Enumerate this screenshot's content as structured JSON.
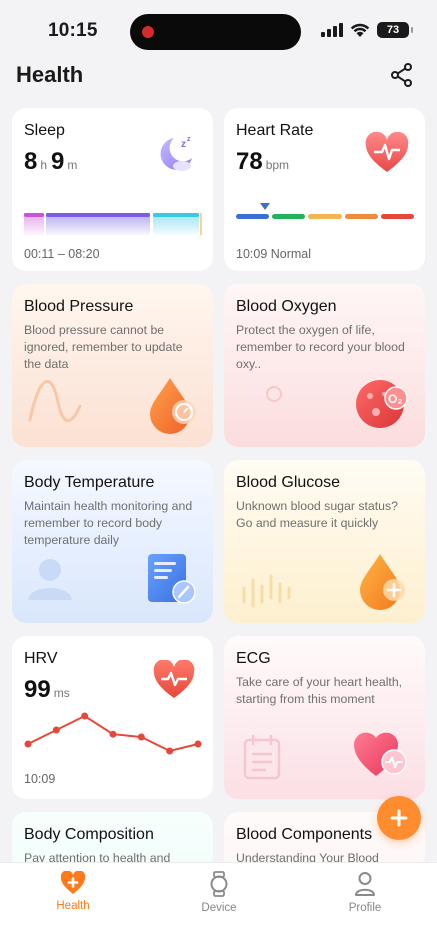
{
  "status_bar": {
    "time": "10:15",
    "battery": "73"
  },
  "header": {
    "title": "Health"
  },
  "cards": {
    "sleep": {
      "title": "Sleep",
      "hours": "8",
      "hours_unit": "h",
      "minutes": "9",
      "minutes_unit": "m",
      "range": "00:11 – 08:20"
    },
    "heart_rate": {
      "title": "Heart Rate",
      "value": "78",
      "unit": "bpm",
      "footer": "10:09 Normal"
    },
    "blood_pressure": {
      "title": "Blood Pressure",
      "desc": "Blood pressure cannot be ignored, remember to update the data"
    },
    "blood_oxygen": {
      "title": "Blood Oxygen",
      "desc": "Protect the oxygen of life, remember to record your blood oxy..",
      "badge": "O₂"
    },
    "body_temperature": {
      "title": "Body Temperature",
      "desc": "Maintain health monitoring and remember to record body temperature daily"
    },
    "blood_glucose": {
      "title": "Blood Glucose",
      "desc": "Unknown blood sugar status? Go and measure it quickly"
    },
    "hrv": {
      "title": "HRV",
      "value": "99",
      "unit": "ms",
      "time": "10:09",
      "trend": [
        3,
        2,
        1,
        2.3,
        2.5,
        3.5,
        3
      ]
    },
    "ecg": {
      "title": "ECG",
      "desc": "Take care of your heart health, starting from this moment"
    },
    "body_composition": {
      "title": "Body Composition",
      "desc": "Pay attention to health and"
    },
    "blood_components": {
      "title": "Blood Components",
      "desc": "Understanding Your Blood"
    }
  },
  "tabs": [
    {
      "label": "Health",
      "icon": "health-cross-icon",
      "active": true
    },
    {
      "label": "Device",
      "icon": "watch-icon",
      "active": false
    },
    {
      "label": "Profile",
      "icon": "person-icon",
      "active": false
    }
  ],
  "colors": {
    "accent": "#ff7a1a",
    "heart_rate_scale": [
      "#3b6fd8",
      "#22b35a",
      "#f4b452",
      "#f08a3c",
      "#e5483a"
    ],
    "hrv_line": "#e5483a"
  }
}
